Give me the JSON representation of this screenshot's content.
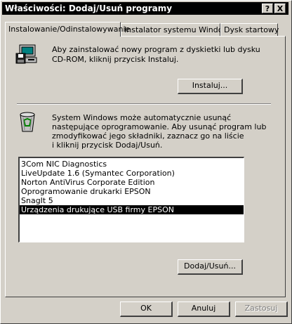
{
  "window": {
    "title": "Właściwości: Dodaj/Usuń programy",
    "help_button": "?",
    "close_button": "X"
  },
  "tabs": [
    {
      "label": "Instalowanie/Odinstalowywanie",
      "active": true
    },
    {
      "label": "Instalator systemu Windows",
      "active": false
    },
    {
      "label": "Dysk startowy",
      "active": false
    }
  ],
  "install": {
    "icon": "floppy-computer-icon",
    "line1": "Aby zainstalować nowy program z dyskietki lub dysku",
    "line2": "CD-ROM, kliknij przycisk Instaluj.",
    "button_label": "Instaluj..."
  },
  "uninstall": {
    "icon": "recycle-bin-icon",
    "line1": "System Windows może automatycznie usunąć",
    "line2": "następujące oprogramowanie. Aby usunąć program lub",
    "line3": "zmodyfikować jego składniki, zaznacz go na liście",
    "line4": "i kliknij przycisk Dodaj/Usuń.",
    "programs": [
      "3Com NIC Diagnostics",
      "LiveUpdate 1.6 (Symantec Corporation)",
      "Norton AntiVirus Corporate Edition",
      "Oprogramowanie drukarki EPSON",
      "SnagIt 5",
      "Urządzenia drukujące USB firmy EPSON"
    ],
    "selected_index": 5,
    "button_label": "Dodaj/Usuń..."
  },
  "footer": {
    "ok_label": "OK",
    "cancel_label": "Anuluj",
    "apply_label": "Zastosuj"
  }
}
